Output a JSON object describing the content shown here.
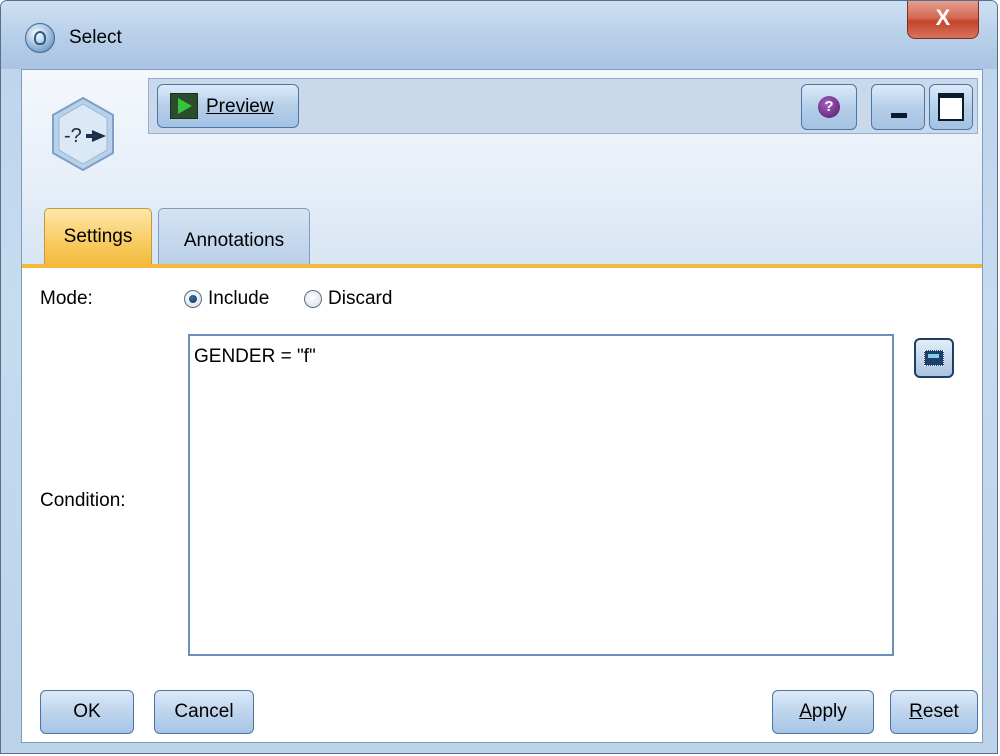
{
  "window": {
    "title": "Select",
    "close_label": "X"
  },
  "toolbar": {
    "preview_label": "Preview",
    "help_label": "?"
  },
  "tabs": [
    {
      "label": "Settings",
      "active": true
    },
    {
      "label": "Annotations",
      "active": false
    }
  ],
  "settings": {
    "mode_label": "Mode:",
    "mode_options": [
      {
        "label": "Include",
        "checked": true
      },
      {
        "label": "Discard",
        "checked": false
      }
    ],
    "condition_label": "Condition:",
    "condition_value": "GENDER = \"f\""
  },
  "buttons": {
    "ok": "OK",
    "cancel": "Cancel",
    "apply_prefix": "",
    "apply_key": "A",
    "apply_rest": "pply",
    "reset_key": "R",
    "reset_rest": "eset"
  },
  "colors": {
    "active_tab": "#f9cd66",
    "close_button": "#c2452b",
    "button_blue": "#b6cfe9"
  }
}
